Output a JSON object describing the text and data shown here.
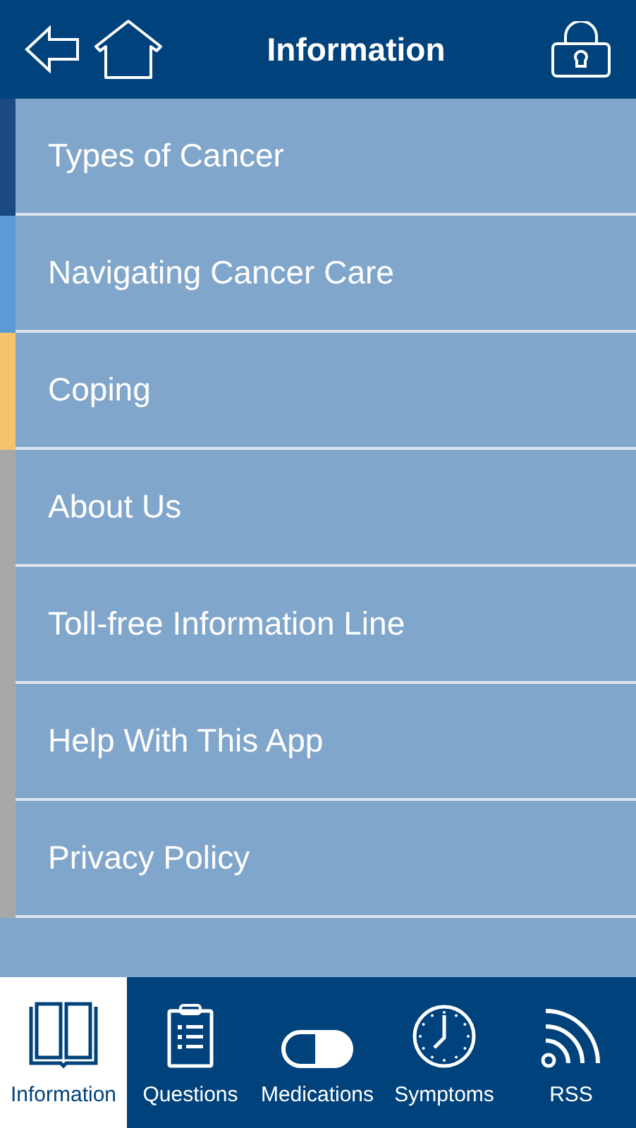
{
  "header": {
    "title": "Information"
  },
  "menu": [
    {
      "label": "Types of Cancer",
      "color": "#1b4a82"
    },
    {
      "label": "Navigating Cancer Care",
      "color": "#5b9bd5"
    },
    {
      "label": "Coping",
      "color": "#f5c46e"
    },
    {
      "label": "About Us",
      "color": "#a8a8a8"
    },
    {
      "label": "Toll-free Information Line",
      "color": "#a8a8a8"
    },
    {
      "label": "Help With This App",
      "color": "#a8a8a8"
    },
    {
      "label": "Privacy Policy",
      "color": "#a8a8a8"
    }
  ],
  "tabs": [
    {
      "label": "Information",
      "kind": "book",
      "selected": true
    },
    {
      "label": "Questions",
      "kind": "clipboard",
      "selected": false
    },
    {
      "label": "Medications",
      "kind": "pill",
      "selected": false
    },
    {
      "label": "Symptoms",
      "kind": "clock",
      "selected": false
    },
    {
      "label": "RSS",
      "kind": "rss",
      "selected": false
    }
  ]
}
